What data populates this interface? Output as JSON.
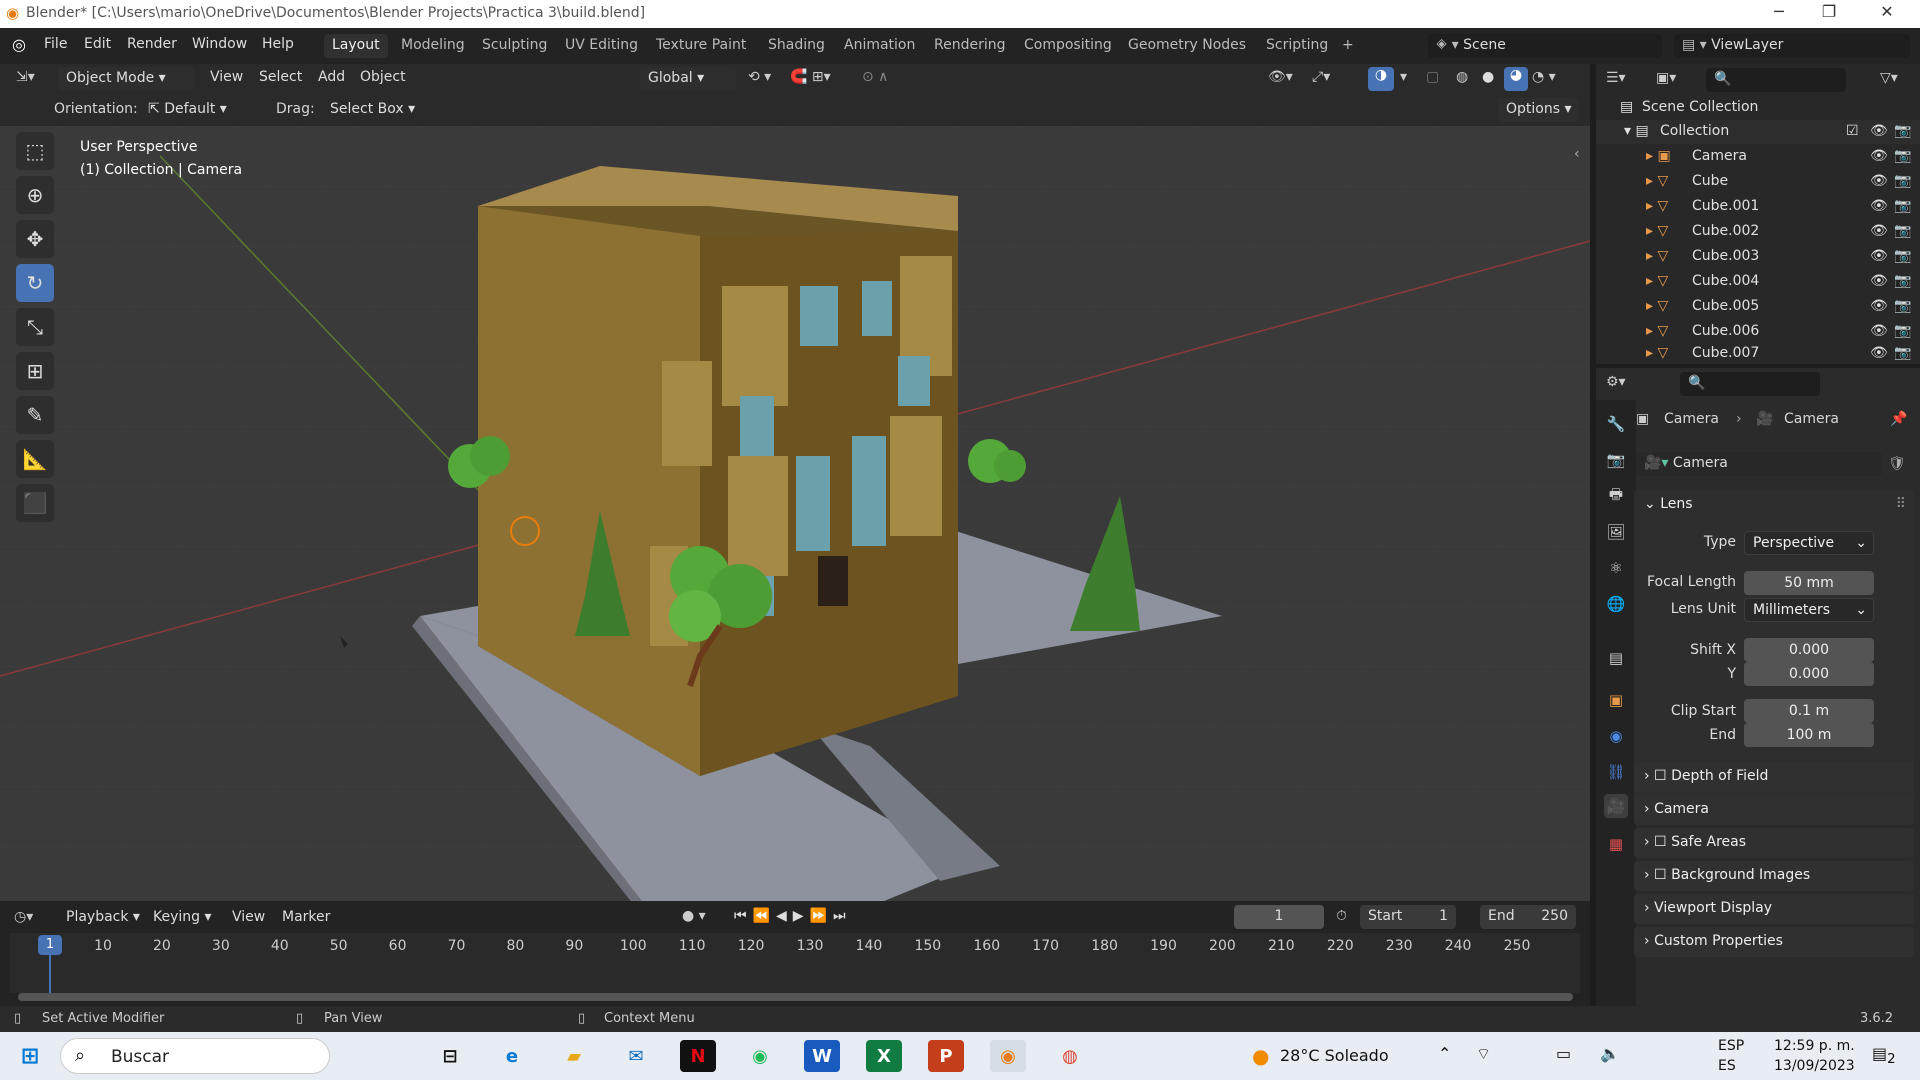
{
  "window": {
    "title": "Blender* [C:\\Users\\mario\\OneDrive\\Documentos\\Blender Projects\\Practica 3\\build.blend]"
  },
  "menu": [
    "File",
    "Edit",
    "Render",
    "Window",
    "Help"
  ],
  "workspaces": [
    "Layout",
    "Modeling",
    "Sculpting",
    "UV Editing",
    "Texture Paint",
    "Shading",
    "Animation",
    "Rendering",
    "Compositing",
    "Geometry Nodes",
    "Scripting",
    "+"
  ],
  "scene": "Scene",
  "viewlayer": "ViewLayer",
  "header": {
    "mode": "Object Mode",
    "view": "View",
    "select": "Select",
    "add": "Add",
    "object": "Object",
    "transform": "Global"
  },
  "toolsettings": {
    "orientation_label": "Orientation:",
    "orientation": "Default",
    "drag_label": "Drag:",
    "drag": "Select Box",
    "options": "Options"
  },
  "viewport": {
    "perspective": "User Perspective",
    "context": "(1) Collection | Camera"
  },
  "outliner": {
    "root": "Scene Collection",
    "collection": "Collection",
    "items": [
      "Camera",
      "Cube",
      "Cube.001",
      "Cube.002",
      "Cube.003",
      "Cube.004",
      "Cube.005",
      "Cube.006",
      "Cube.007"
    ]
  },
  "props": {
    "bc1": "Camera",
    "bc2": "Camera",
    "datablock": "Camera",
    "lens": "Lens",
    "type_label": "Type",
    "type": "Perspective",
    "focal_label": "Focal Length",
    "focal": "50 mm",
    "unit_label": "Lens Unit",
    "unit": "Millimeters",
    "shiftx_label": "Shift X",
    "shiftx": "0.000",
    "shifty_label": "Y",
    "shifty": "0.000",
    "clipstart_label": "Clip Start",
    "clipstart": "0.1 m",
    "clipend_label": "End",
    "clipend": "100 m",
    "panels": [
      "Depth of Field",
      "Camera",
      "Safe Areas",
      "Background Images",
      "Viewport Display",
      "Custom Properties"
    ]
  },
  "timeline": {
    "playback": "Playback",
    "keying": "Keying",
    "view": "View",
    "marker": "Marker",
    "frame": "1",
    "start_label": "Start",
    "start": "1",
    "end_label": "End",
    "end": "250",
    "ticks": [
      "1",
      "10",
      "20",
      "30",
      "40",
      "50",
      "60",
      "70",
      "80",
      "90",
      "100",
      "110",
      "120",
      "130",
      "140",
      "150",
      "160",
      "170",
      "180",
      "190",
      "200",
      "210",
      "220",
      "230",
      "240",
      "250"
    ]
  },
  "status": {
    "left": "Set Active Modifier",
    "mid": "Pan View",
    "right": "Context Menu",
    "version": "3.6.2"
  },
  "taskbar": {
    "search": "Buscar",
    "weather": "28°C  Soleado",
    "lang1": "ESP",
    "lang2": "ES",
    "time": "12:59 p. m.",
    "date": "13/09/2023",
    "notif": "2"
  }
}
